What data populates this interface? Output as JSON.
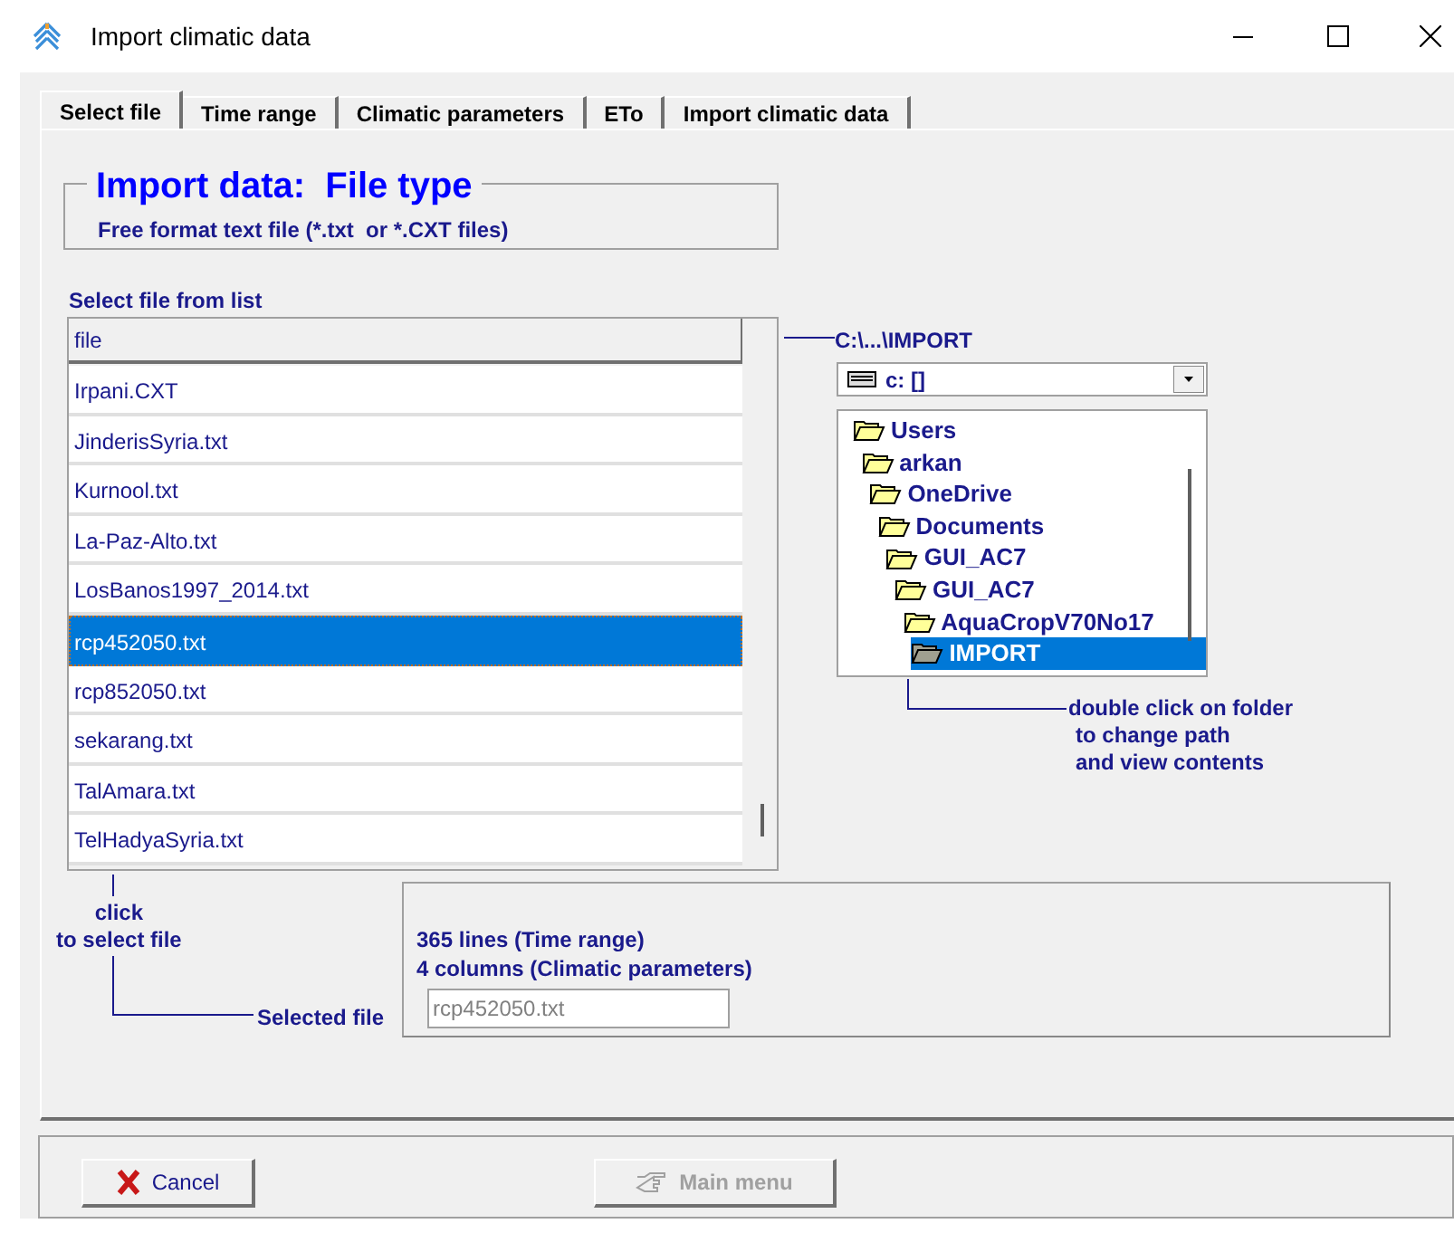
{
  "window": {
    "title": "Import climatic data"
  },
  "tabs": [
    {
      "label": "Select file",
      "selected": true
    },
    {
      "label": "Time range",
      "selected": false
    },
    {
      "label": "Climatic parameters",
      "selected": false
    },
    {
      "label": "ETo",
      "selected": false
    },
    {
      "label": "Import climatic data",
      "selected": false
    }
  ],
  "file_type_group": {
    "title": "Import data:  File type",
    "description": "Free format text file (*.txt  or *.CXT files)"
  },
  "file_list": {
    "label": "Select file from list",
    "column": "file",
    "rows": [
      {
        "name": "Irpani.CXT",
        "selected": false
      },
      {
        "name": "JinderisSyria.txt",
        "selected": false
      },
      {
        "name": "Kurnool.txt",
        "selected": false
      },
      {
        "name": "La-Paz-Alto.txt",
        "selected": false
      },
      {
        "name": "LosBanos1997_2014.txt",
        "selected": false
      },
      {
        "name": "rcp452050.txt",
        "selected": true
      },
      {
        "name": "rcp852050.txt",
        "selected": false
      },
      {
        "name": "sekarang.txt",
        "selected": false
      },
      {
        "name": "TalAmara.txt",
        "selected": false
      },
      {
        "name": "TelHadyaSyria.txt",
        "selected": false
      }
    ]
  },
  "path": "C:\\...\\IMPORT",
  "drive": {
    "value": "c: []"
  },
  "folders": [
    {
      "name": "Users",
      "selected": false,
      "children": [
        {
          "name": "arkan",
          "selected": false,
          "children": [
            {
              "name": "OneDrive",
              "selected": false,
              "children": [
                {
                  "name": "Documents",
                  "selected": false,
                  "children": [
                    {
                      "name": "GUI_AC7",
                      "selected": false,
                      "children": [
                        {
                          "name": "GUI_AC7",
                          "selected": false,
                          "children": [
                            {
                              "name": "AquaCropV70No17",
                              "selected": false,
                              "children": [
                                {
                                  "name": "IMPORT",
                                  "selected": true
                                }
                              ]
                            }
                          ]
                        }
                      ]
                    }
                  ]
                }
              ]
            }
          ]
        }
      ]
    }
  ],
  "folder_hint": [
    "double click on folder",
    "to change path",
    "and view contents"
  ],
  "click_hint": [
    "click",
    "to select file"
  ],
  "selected_file_label": "Selected file",
  "info": [
    "365 lines (Time range)",
    "4 columns (Climatic parameters)"
  ],
  "selected_file": {
    "value": "rcp452050.txt",
    "disabled": true
  },
  "buttons": [
    {
      "label": "Cancel",
      "kind": "cancel",
      "disabled": false
    },
    {
      "label": "Main menu",
      "kind": "main_menu",
      "disabled": true
    }
  ]
}
